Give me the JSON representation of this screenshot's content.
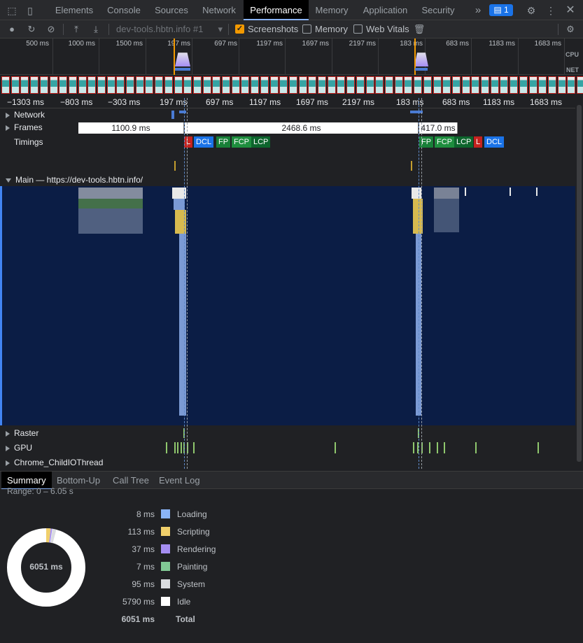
{
  "tabs": [
    {
      "label": "Elements"
    },
    {
      "label": "Console"
    },
    {
      "label": "Sources"
    },
    {
      "label": "Network"
    },
    {
      "label": "Performance"
    },
    {
      "label": "Memory"
    },
    {
      "label": "Application"
    },
    {
      "label": "Security"
    }
  ],
  "badge_count": "1",
  "toolbar": {
    "profile_select": "dev-tools.hbtn.info #1",
    "screenshots_label": "Screenshots",
    "memory_label": "Memory",
    "web_vitals_label": "Web Vitals",
    "screenshots_checked": true,
    "memory_checked": false,
    "web_vitals_checked": false
  },
  "overview": {
    "ticks": [
      "500 ms",
      "1000 ms",
      "1500 ms",
      "197 ms",
      "697 ms",
      "1197 ms",
      "1697 ms",
      "2197 ms",
      "183 ms",
      "683 ms",
      "1183 ms",
      "1683 ms"
    ],
    "cpu_label": "CPU",
    "net_label": "NET"
  },
  "ruler": {
    "ticks": [
      "−1303 ms",
      "−803 ms",
      "−303 ms",
      "197 ms",
      "697 ms",
      "1197 ms",
      "1697 ms",
      "2197 ms",
      "183 ms",
      "683 ms",
      "1183 ms",
      "1683 ms"
    ]
  },
  "tracks": {
    "network": "Network",
    "frames": "Frames",
    "timings": "Timings",
    "main": "Main — https://dev-tools.hbtn.info/",
    "raster": "Raster",
    "gpu": "GPU",
    "io": "Chrome_ChildIOThread"
  },
  "frames": [
    "1100.9 ms",
    "2468.6 ms",
    "417.0 ms"
  ],
  "timings_group1": [
    "L",
    "DCL",
    "FP",
    "FCP",
    "LCP"
  ],
  "timings_group2": [
    "FP",
    "FCP",
    "LCP",
    "L",
    "DCL"
  ],
  "bottom_tabs": [
    "Summary",
    "Bottom-Up",
    "Call Tree",
    "Event Log"
  ],
  "summary": {
    "range": "Range: 0 – 6.05 s",
    "total_center": "6051 ms",
    "rows": [
      {
        "value": "8 ms",
        "label": "Loading",
        "color": "#8ab4f8"
      },
      {
        "value": "113 ms",
        "label": "Scripting",
        "color": "#f0cf6b"
      },
      {
        "value": "37 ms",
        "label": "Rendering",
        "color": "#a58ef2"
      },
      {
        "value": "7 ms",
        "label": "Painting",
        "color": "#81c995"
      },
      {
        "value": "95 ms",
        "label": "System",
        "color": "#dadce0"
      },
      {
        "value": "5790 ms",
        "label": "Idle",
        "color": "#ffffff"
      }
    ],
    "total_value": "6051 ms",
    "total_label": "Total"
  }
}
